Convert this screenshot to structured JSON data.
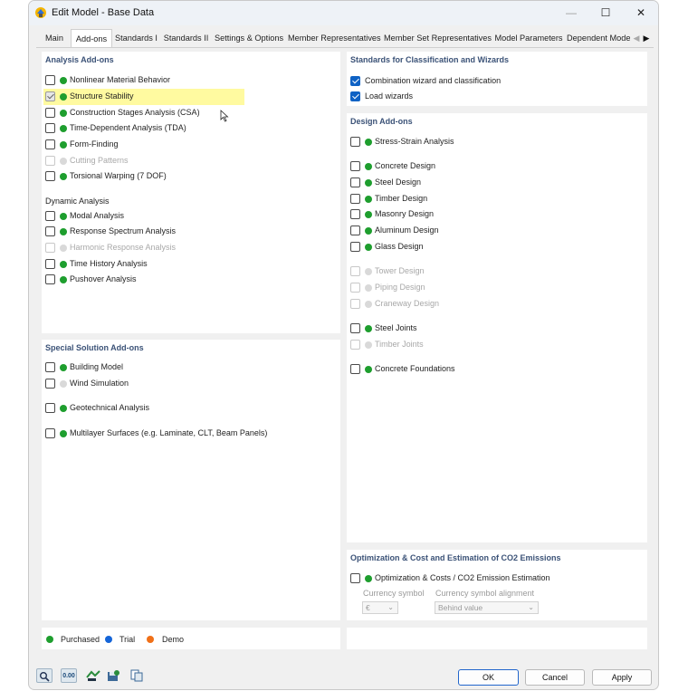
{
  "window": {
    "title": "Edit Model - Base Data"
  },
  "titlebar_buttons": {
    "minimize": "—",
    "maximize": "☐",
    "close": "✕"
  },
  "tabs": [
    "Main",
    "Add-ons",
    "Standards I",
    "Standards II",
    "Settings & Options",
    "Member Representatives",
    "Member Set Representatives",
    "Model Parameters",
    "Dependent Mode"
  ],
  "active_tab": "Add-ons",
  "analysis": {
    "title": "Analysis Add-ons",
    "items": [
      {
        "label": "Nonlinear Material Behavior",
        "checked": false,
        "status": "purchased"
      },
      {
        "label": "Structure Stability",
        "checked": true,
        "status": "purchased"
      },
      {
        "label": "Construction Stages Analysis (CSA)",
        "checked": false,
        "status": "purchased"
      },
      {
        "label": "Time-Dependent Analysis (TDA)",
        "checked": false,
        "status": "purchased"
      },
      {
        "label": "Form-Finding",
        "checked": false,
        "status": "purchased"
      },
      {
        "label": "Cutting Patterns",
        "checked": false,
        "status": "unavailable"
      },
      {
        "label": "Torsional Warping (7 DOF)",
        "checked": false,
        "status": "purchased"
      }
    ],
    "dynamic_title": "Dynamic Analysis",
    "dynamic_items": [
      {
        "label": "Modal Analysis",
        "checked": false,
        "status": "purchased"
      },
      {
        "label": "Response Spectrum Analysis",
        "checked": false,
        "status": "purchased"
      },
      {
        "label": "Harmonic Response Analysis",
        "checked": false,
        "status": "unavailable"
      },
      {
        "label": "Time History Analysis",
        "checked": false,
        "status": "purchased"
      },
      {
        "label": "Pushover Analysis",
        "checked": false,
        "status": "purchased"
      }
    ]
  },
  "special": {
    "title": "Special Solution Add-ons",
    "items": [
      {
        "label": "Building Model",
        "checked": false,
        "status": "purchased"
      },
      {
        "label": "Wind Simulation",
        "checked": false,
        "status": "unavailable_text"
      },
      {
        "label": "Geotechnical Analysis",
        "checked": false,
        "status": "purchased"
      },
      {
        "label": "Multilayer Surfaces (e.g. Laminate, CLT, Beam Panels)",
        "checked": false,
        "status": "purchased"
      }
    ]
  },
  "standards": {
    "title": "Standards for Classification and Wizards",
    "items": [
      {
        "label": "Combination wizard and classification",
        "checked": true
      },
      {
        "label": "Load wizards",
        "checked": true
      }
    ]
  },
  "design": {
    "title": "Design Add-ons",
    "items": [
      {
        "label": "Stress-Strain Analysis",
        "checked": false,
        "status": "purchased"
      },
      {
        "label": "Concrete Design",
        "checked": false,
        "status": "purchased"
      },
      {
        "label": "Steel Design",
        "checked": false,
        "status": "purchased"
      },
      {
        "label": "Timber Design",
        "checked": false,
        "status": "purchased"
      },
      {
        "label": "Masonry Design",
        "checked": false,
        "status": "purchased"
      },
      {
        "label": "Aluminum Design",
        "checked": false,
        "status": "purchased"
      },
      {
        "label": "Glass Design",
        "checked": false,
        "status": "purchased"
      },
      {
        "label": "Tower Design",
        "checked": false,
        "status": "unavailable"
      },
      {
        "label": "Piping Design",
        "checked": false,
        "status": "unavailable"
      },
      {
        "label": "Craneway Design",
        "checked": false,
        "status": "unavailable"
      },
      {
        "label": "Steel Joints",
        "checked": false,
        "status": "purchased"
      },
      {
        "label": "Timber Joints",
        "checked": false,
        "status": "unavailable"
      },
      {
        "label": "Concrete Foundations",
        "checked": false,
        "status": "purchased"
      }
    ]
  },
  "optimization": {
    "title": "Optimization & Cost and Estimation of CO2 Emissions",
    "item": {
      "label": "Optimization & Costs / CO2 Emission Estimation",
      "checked": false,
      "status": "purchased"
    },
    "currency_symbol_label": "Currency symbol",
    "currency_symbol_value": "€",
    "currency_alignment_label": "Currency symbol alignment",
    "currency_alignment_value": "Behind value"
  },
  "legend": {
    "purchased": "Purchased",
    "trial": "Trial",
    "demo": "Demo"
  },
  "colors": {
    "purchased": "#1e9e2e",
    "trial": "#1565d8",
    "demo": "#f07018",
    "unavailable": "#d9d9d9",
    "accent": "#0f62c4"
  },
  "icons": [
    "search-icon",
    "units-icon",
    "model-transfer-icon",
    "settings-save-icon",
    "copy-icon"
  ],
  "tool_labels": {
    "units": "0.00"
  },
  "buttons": {
    "ok": "OK",
    "cancel": "Cancel",
    "apply": "Apply"
  }
}
